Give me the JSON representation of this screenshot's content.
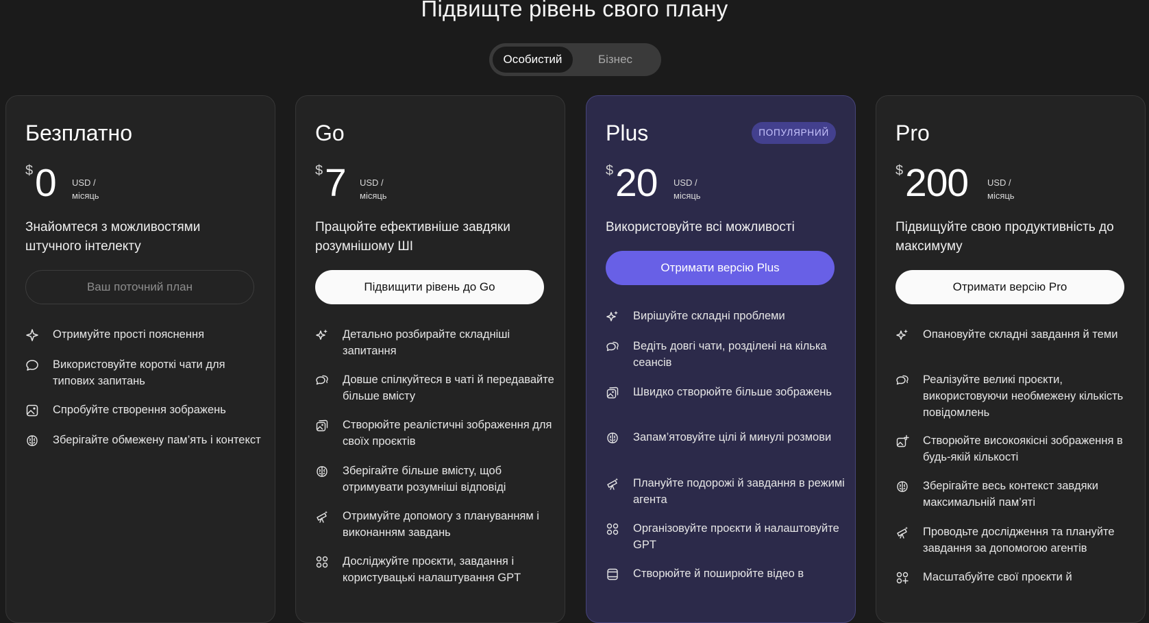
{
  "page": {
    "title": "Підвищте рівень свого плану"
  },
  "toggle": {
    "personal": "Особистий",
    "business": "Бізнес"
  },
  "plans": [
    {
      "name": "Безплатно",
      "currency": "$",
      "price": "0",
      "unit1": "USD /",
      "unit2": "місяць",
      "tagline": "Знайомтеся з можливостями штучного інтелекту",
      "button": "Ваш поточний план",
      "features": [
        {
          "icon": "sparkle-icon",
          "text": "Отримуйте прості пояснення"
        },
        {
          "icon": "chat-bubble-icon",
          "text": "Використовуйте короткі чати для типових запитань"
        },
        {
          "icon": "image-icon",
          "text": "Спробуйте створення зображень"
        },
        {
          "icon": "brain-icon",
          "text": "Зберігайте обмежену пам’ять і контекст"
        }
      ]
    },
    {
      "name": "Go",
      "currency": "$",
      "price": "7",
      "unit1": "USD /",
      "unit2": "місяць",
      "tagline": "Працюйте ефективніше завдяки розумнішому ШІ",
      "button": "Підвищити рівень до Go",
      "features": [
        {
          "icon": "sparkles-icon",
          "text": "Детально розбирайте складніші запитання"
        },
        {
          "icon": "chat-bubbles-icon",
          "text": "Довше спілкуйтеся в чаті й передавайте більше вмісту"
        },
        {
          "icon": "images-icon",
          "text": "Створюйте реалістичні зображення для своїх проєктів"
        },
        {
          "icon": "brain-icon",
          "text": "Зберігайте більше вмісту, щоб отримувати розумніші відповіді"
        },
        {
          "icon": "telescope-icon",
          "text": "Отримуйте допомогу з плануванням і виконанням завдань"
        },
        {
          "icon": "apps-icon",
          "text": "Досліджуйте проєкти, завдання і користувацькі налаштування GPT"
        }
      ]
    },
    {
      "name": "Plus",
      "badge": "ПОПУЛЯРНИЙ",
      "currency": "$",
      "price": "20",
      "unit1": "USD /",
      "unit2": "місяць",
      "tagline": "Використовуйте всі можливості",
      "button": "Отримати версію Plus",
      "features": [
        {
          "icon": "sparkles-icon",
          "text": "Вирішуйте складні проблеми"
        },
        {
          "icon": "chat-bubbles-icon",
          "text": "Ведіть довгі чати, розділені на кілька сеансів"
        },
        {
          "icon": "images-icon",
          "text": "Швидко створюйте більше зображень"
        },
        {
          "icon": "brain-icon",
          "text": "Запам’ятовуйте цілі й минулі розмови"
        },
        {
          "icon": "telescope-icon",
          "text": "Плануйте подорожі й завдання в режимі агента"
        },
        {
          "icon": "apps-icon",
          "text": "Організовуйте проєкти й налаштовуйте GPT"
        },
        {
          "icon": "video-icon",
          "text": "Створюйте й поширюйте відео в"
        }
      ]
    },
    {
      "name": "Pro",
      "currency": "$",
      "price": "200",
      "unit1": "USD /",
      "unit2": "місяць",
      "tagline": "Підвищуйте свою продуктивність до максимуму",
      "button": "Отримати версію Pro",
      "features": [
        {
          "icon": "sparkles-icon",
          "text": "Опановуйте складні завдання й теми"
        },
        {
          "icon": "chat-bubbles-icon",
          "text": "Реалізуйте великі проєкти, використовуючи необмежену кількість повідомлень"
        },
        {
          "icon": "images-plus-icon",
          "text": "Створюйте високоякісні зображення в будь-якій кількості"
        },
        {
          "icon": "brain-icon",
          "text": "Зберігайте весь контекст завдяки максимальній пам’яті"
        },
        {
          "icon": "telescope-icon",
          "text": "Проводьте дослідження та плануйте завдання за допомогою агентів"
        },
        {
          "icon": "apps-plus-icon",
          "text": "Масштабуйте свої проєкти й"
        }
      ]
    }
  ]
}
